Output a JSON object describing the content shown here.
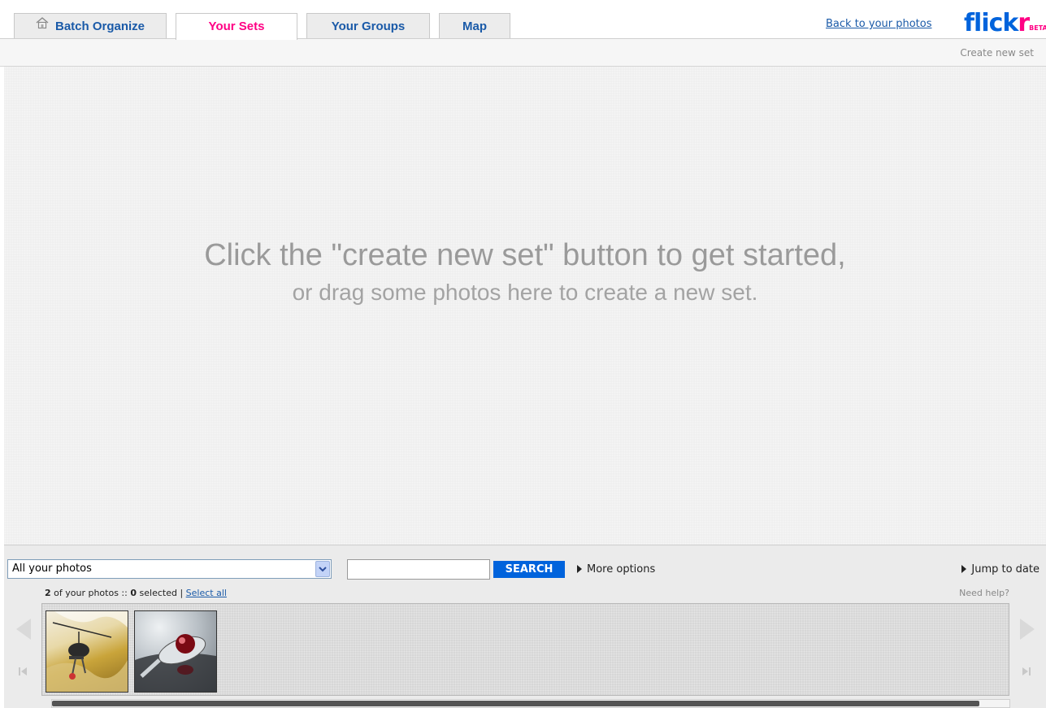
{
  "tabs": [
    {
      "label": "Batch Organize",
      "icon": "home-icon",
      "active": false
    },
    {
      "label": "Your Sets",
      "active": true
    },
    {
      "label": "Your Groups",
      "active": false
    },
    {
      "label": "Map",
      "active": false
    }
  ],
  "header": {
    "back_link": "Back to your photos",
    "logo": {
      "blue": "flick",
      "pink": "r",
      "badge": "BETA"
    }
  },
  "toolbar": {
    "create_set": "Create new set"
  },
  "canvas": {
    "message_line1": "Click the \"create new set\" button to get started,",
    "message_line2": "or drag some photos here to create a new set."
  },
  "tray": {
    "filter_selected": "All your photos",
    "search_value": "",
    "search_button": "SEARCH",
    "more_options": "More options",
    "jump_to_date": "Jump to date",
    "photo_count": "2",
    "count_text": " of your photos :: ",
    "selected_count": "0",
    "selected_text": " selected | ",
    "select_all": "Select all",
    "need_help": "Need help?",
    "photos": [
      {
        "subject": "helicopter-photo"
      },
      {
        "subject": "spoon-photo"
      }
    ],
    "scroll_position": 0.97
  },
  "colors": {
    "accent_blue": "#0063dc",
    "accent_pink": "#ff0084",
    "link_blue": "#1a5aa8",
    "canvas_bg": "#efefef"
  }
}
